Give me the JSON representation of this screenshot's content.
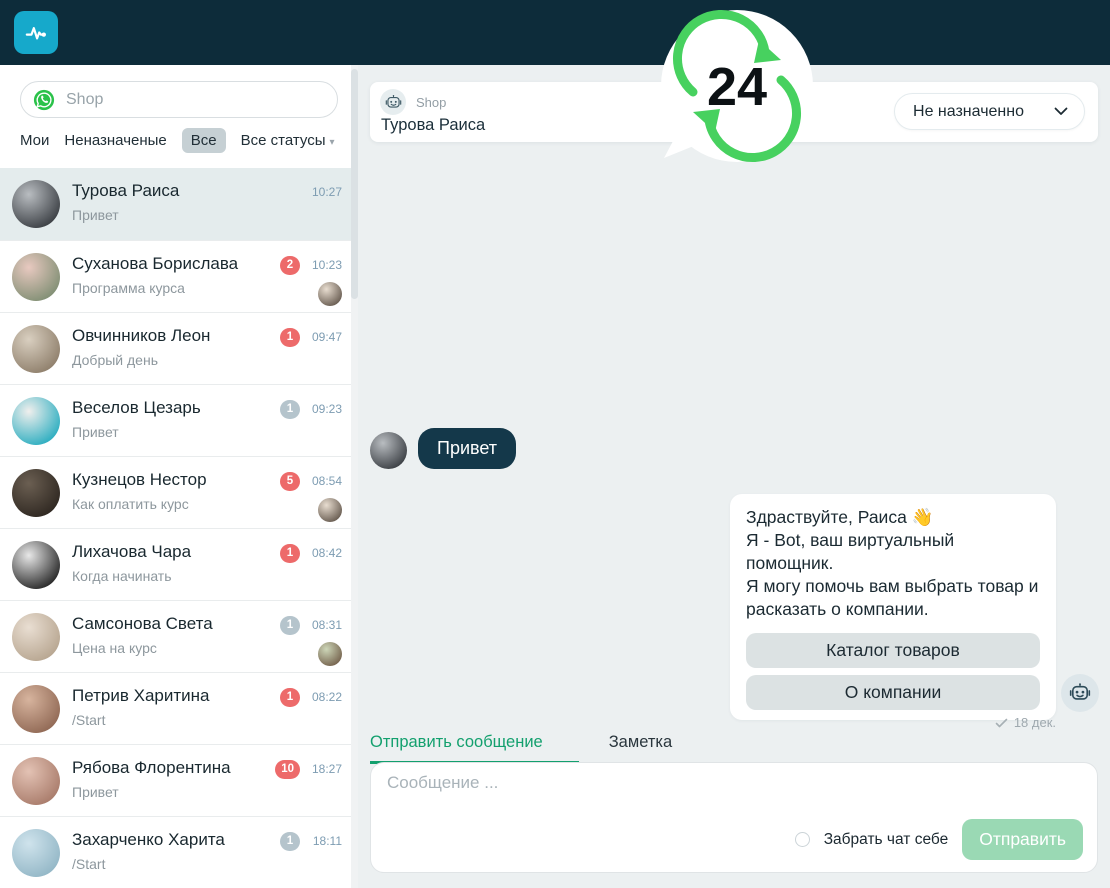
{
  "logo": {
    "text": "24"
  },
  "sidebar": {
    "channel": "Shop",
    "filters": [
      {
        "label": "Мои"
      },
      {
        "label": "Неназначеные"
      },
      {
        "label": "Все",
        "selected": true
      },
      {
        "label": "Все статусы",
        "dropdown": true
      }
    ],
    "chats": [
      {
        "name": "Турова Раиса",
        "preview": "Привет",
        "time": "10:27",
        "badge": null,
        "badge_color": null,
        "selected": true,
        "agent": null,
        "avatar": [
          "#b9bdc1",
          "#33373c"
        ]
      },
      {
        "name": "Суханова Борислава",
        "preview": "Программа курса",
        "time": "10:23",
        "badge": "2",
        "badge_color": "red",
        "selected": false,
        "agent": "m",
        "avatar": [
          "#e8c9c0",
          "#7a8b6f"
        ]
      },
      {
        "name": "Овчинников Леон",
        "preview": "Добрый день",
        "time": "09:47",
        "badge": "1",
        "badge_color": "red",
        "selected": false,
        "agent": null,
        "avatar": [
          "#d9cfc0",
          "#8a7a66"
        ]
      },
      {
        "name": "Веселов Цезарь",
        "preview": "Привет",
        "time": "09:23",
        "badge": "1",
        "badge_color": "gray",
        "selected": false,
        "agent": null,
        "avatar": [
          "#f0efed",
          "#1fa9bd"
        ]
      },
      {
        "name": "Кузнецов Нестор",
        "preview": "Как оплатить курс",
        "time": "08:54",
        "badge": "5",
        "badge_color": "red",
        "selected": false,
        "agent": "m",
        "avatar": [
          "#6b5f52",
          "#2b241e"
        ]
      },
      {
        "name": "Лихачова Чара",
        "preview": "Когда начинать",
        "time": "08:42",
        "badge": "1",
        "badge_color": "red",
        "selected": false,
        "agent": null,
        "avatar": [
          "#e8e8e8",
          "#1a1a1a"
        ]
      },
      {
        "name": "Самсонова Света",
        "preview": "Цена на курс",
        "time": "08:31",
        "badge": "1",
        "badge_color": "gray",
        "selected": false,
        "agent": "f",
        "avatar": [
          "#e9ded2",
          "#b4a28c"
        ]
      },
      {
        "name": "Петрив Харитина",
        "preview": "/Start",
        "time": "08:22",
        "badge": "1",
        "badge_color": "red",
        "selected": false,
        "agent": null,
        "avatar": [
          "#d7b49e",
          "#8c6450"
        ]
      },
      {
        "name": "Рябова Флорентина",
        "preview": "Привет",
        "time": "18:27",
        "badge": "10",
        "badge_color": "red",
        "selected": false,
        "agent": null,
        "avatar": [
          "#e3c2b4",
          "#a57766"
        ]
      },
      {
        "name": "Захарченко Харита",
        "preview": "/Start",
        "time": "18:11",
        "badge": "1",
        "badge_color": "gray",
        "selected": false,
        "agent": null,
        "avatar": [
          "#cfe3ec",
          "#8fb4c4"
        ]
      }
    ],
    "agent_avatars": {
      "m": [
        "#e8ddd0",
        "#5f5348"
      ],
      "f": [
        "#cdd6b8",
        "#6f5b46"
      ]
    }
  },
  "chat": {
    "header": {
      "channel": "Shop",
      "contact": "Турова Раиса",
      "assignee": "Не назначенно"
    },
    "incoming": {
      "text": "Привет"
    },
    "bot_message": {
      "lines": [
        "Здраствуйте, Раиса 👋",
        "Я - Bot, ваш виртуальный помощник.",
        "Я могу помочь вам выбрать товар и расказать о компании."
      ],
      "buttons": [
        "Каталог товаров",
        "О компании"
      ],
      "status_time": "18 дек."
    }
  },
  "composer": {
    "tabs": [
      "Отправить сообщение",
      "Заметка"
    ],
    "placeholder": "Сообщение ...",
    "checkbox_label": "Забрать чат себе",
    "send_label": "Отправить"
  },
  "colors": {
    "topbar": "#0d2c3a",
    "brand_cyan": "#16a9cb",
    "logo_green": "#47d15f",
    "whatsapp_green": "#2bc24a",
    "accent_green": "#13a06e",
    "badge_red": "#ed6a6a",
    "badge_gray": "#b5c4cc",
    "incoming_bubble": "#14384a",
    "send_button": "#9ad9b4",
    "selected_chat": "#e4eced"
  }
}
